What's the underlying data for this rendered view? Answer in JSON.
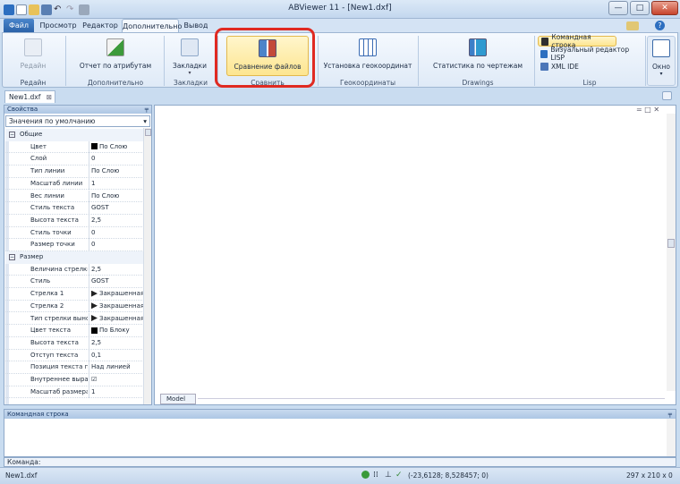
{
  "window": {
    "title": "ABViewer 11 - [New1.dxf]"
  },
  "tabs": [
    "Файл",
    "Просмотр",
    "Редактор",
    "Дополнительно",
    "Вывод"
  ],
  "ribbon": {
    "edit_btn": "Редайн",
    "edit_group": "Редайн",
    "report_btn": "Отчет по атрибутам",
    "extra_group": "Дополнительно",
    "bookmarks_btn": "Закладки",
    "bookmarks_group": "Закладки",
    "compare_btn": "Сравнение файлов",
    "compare_group": "Сравнить",
    "geo_btn": "Установка геокоординат",
    "geo_group": "Геокоординаты",
    "stats_btn": "Статистика по чертежам",
    "drawings_group": "Drawings",
    "lisp_cmd": "Командная строка",
    "lisp_editor": "Визуальный редактор LISP",
    "xml_ide": "XML IDE",
    "lisp_group": "Lisp",
    "window_btn": "Окно"
  },
  "doc_tab": "New1.dxf",
  "properties": {
    "header": "Свойства",
    "combo": "Значения по умолчанию",
    "cat_general": "Общие",
    "cat_size": "Размер",
    "rows_general": [
      {
        "label": "Цвет",
        "value": "По Слою",
        "swatch": true
      },
      {
        "label": "Слой",
        "value": "0"
      },
      {
        "label": "Тип линии",
        "value": "По Слою"
      },
      {
        "label": "Масштаб линии",
        "value": "1"
      },
      {
        "label": "Вес линии",
        "value": "По Слою"
      },
      {
        "label": "Стиль текста",
        "value": "GOST"
      },
      {
        "label": "Высота текста",
        "value": "2,5"
      },
      {
        "label": "Стиль точки",
        "value": "0"
      },
      {
        "label": "Размер точки",
        "value": "0"
      }
    ],
    "rows_size": [
      {
        "label": "Величина стрелки",
        "value": "2,5"
      },
      {
        "label": "Стиль",
        "value": "GOST"
      },
      {
        "label": "Стрелка 1",
        "value": "Закрашенная",
        "arrow": true
      },
      {
        "label": "Стрелка 2",
        "value": "Закрашенная",
        "arrow": true
      },
      {
        "label": "Тип стрелки выноски",
        "value": "Закрашенная",
        "arrow": true
      },
      {
        "label": "Цвет текста",
        "value": "По Блоку",
        "swatch": true
      },
      {
        "label": "Высота текста",
        "value": "2,5"
      },
      {
        "label": "Отступ текста",
        "value": "0,1"
      },
      {
        "label": "Позиция текста по вертикали",
        "value": "Над линией"
      },
      {
        "label": "Внутреннее выравнивание",
        "value": "☑"
      },
      {
        "label": "Масштаб размера",
        "value": "1"
      }
    ]
  },
  "canvas": {
    "layout_tab": "Model"
  },
  "command": {
    "panel_title": "Командная строка",
    "prompt": "Команда:"
  },
  "status": {
    "file": "New1.dxf",
    "coords": "(-23,6128; 8,528457; 0)",
    "size": "297 x 210 x 0"
  },
  "colors": {
    "accent_red": "#e02a22",
    "highlight": "#fde590",
    "file_tab": "#2b62a8"
  }
}
